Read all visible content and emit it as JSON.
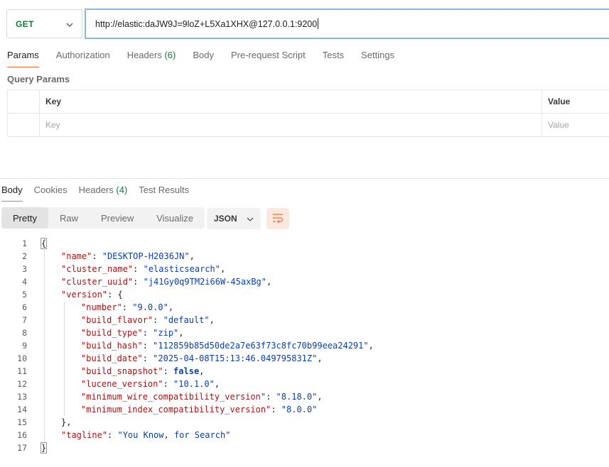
{
  "request": {
    "method": "GET",
    "url": "http://elastic:daJW9J=9loZ+L5Xa1XHX@127.0.0.1:9200"
  },
  "request_tabs": [
    {
      "label": "Params",
      "count": ""
    },
    {
      "label": "Authorization",
      "count": ""
    },
    {
      "label": "Headers",
      "count": "(6)"
    },
    {
      "label": "Body",
      "count": ""
    },
    {
      "label": "Pre-request Script",
      "count": ""
    },
    {
      "label": "Tests",
      "count": ""
    },
    {
      "label": "Settings",
      "count": ""
    }
  ],
  "query_params": {
    "title": "Query Params",
    "header_key": "Key",
    "header_value": "Value",
    "key_placeholder": "Key",
    "value_placeholder": "Value"
  },
  "response_tabs": [
    {
      "label": "Body",
      "count": ""
    },
    {
      "label": "Cookies",
      "count": ""
    },
    {
      "label": "Headers",
      "count": "(4)"
    },
    {
      "label": "Test Results",
      "count": ""
    }
  ],
  "view_modes": [
    "Pretty",
    "Raw",
    "Preview",
    "Visualize"
  ],
  "format": "JSON",
  "colors": {
    "accent": "#ff6c37",
    "method_green": "#0a7d36",
    "json_key": "#a31515",
    "json_string": "#0c3ea8"
  },
  "code_lines": [
    {
      "n": "1",
      "indent": 0,
      "tokens": [
        {
          "t": "{",
          "c": "p"
        }
      ]
    },
    {
      "n": "2",
      "indent": 1,
      "tokens": [
        {
          "t": "\"name\"",
          "c": "k"
        },
        {
          "t": ": ",
          "c": "p"
        },
        {
          "t": "\"DESKTOP-H2036JN\"",
          "c": "s"
        },
        {
          "t": ",",
          "c": "p"
        }
      ]
    },
    {
      "n": "3",
      "indent": 1,
      "tokens": [
        {
          "t": "\"cluster_name\"",
          "c": "k"
        },
        {
          "t": ": ",
          "c": "p"
        },
        {
          "t": "\"elasticsearch\"",
          "c": "s"
        },
        {
          "t": ",",
          "c": "p"
        }
      ]
    },
    {
      "n": "4",
      "indent": 1,
      "tokens": [
        {
          "t": "\"cluster_uuid\"",
          "c": "k"
        },
        {
          "t": ": ",
          "c": "p"
        },
        {
          "t": "\"j41Gy0q9TM2i66W-45axBg\"",
          "c": "s"
        },
        {
          "t": ",",
          "c": "p"
        }
      ]
    },
    {
      "n": "5",
      "indent": 1,
      "tokens": [
        {
          "t": "\"version\"",
          "c": "k"
        },
        {
          "t": ": {",
          "c": "p"
        }
      ]
    },
    {
      "n": "6",
      "indent": 2,
      "tokens": [
        {
          "t": "\"number\"",
          "c": "k"
        },
        {
          "t": ": ",
          "c": "p"
        },
        {
          "t": "\"9.0.0\"",
          "c": "s"
        },
        {
          "t": ",",
          "c": "p"
        }
      ]
    },
    {
      "n": "7",
      "indent": 2,
      "tokens": [
        {
          "t": "\"build_flavor\"",
          "c": "k"
        },
        {
          "t": ": ",
          "c": "p"
        },
        {
          "t": "\"default\"",
          "c": "s"
        },
        {
          "t": ",",
          "c": "p"
        }
      ]
    },
    {
      "n": "8",
      "indent": 2,
      "tokens": [
        {
          "t": "\"build_type\"",
          "c": "k"
        },
        {
          "t": ": ",
          "c": "p"
        },
        {
          "t": "\"zip\"",
          "c": "s"
        },
        {
          "t": ",",
          "c": "p"
        }
      ]
    },
    {
      "n": "9",
      "indent": 2,
      "tokens": [
        {
          "t": "\"build_hash\"",
          "c": "k"
        },
        {
          "t": ": ",
          "c": "p"
        },
        {
          "t": "\"112859b85d50de2a7e63f73c8fc70b99eea24291\"",
          "c": "s"
        },
        {
          "t": ",",
          "c": "p"
        }
      ]
    },
    {
      "n": "10",
      "indent": 2,
      "tokens": [
        {
          "t": "\"build_date\"",
          "c": "k"
        },
        {
          "t": ": ",
          "c": "p"
        },
        {
          "t": "\"2025-04-08T15:13:46.049795831Z\"",
          "c": "s"
        },
        {
          "t": ",",
          "c": "p"
        }
      ]
    },
    {
      "n": "11",
      "indent": 2,
      "tokens": [
        {
          "t": "\"build_snapshot\"",
          "c": "k"
        },
        {
          "t": ": ",
          "c": "p"
        },
        {
          "t": "false",
          "c": "kw"
        },
        {
          "t": ",",
          "c": "p"
        }
      ]
    },
    {
      "n": "12",
      "indent": 2,
      "tokens": [
        {
          "t": "\"lucene_version\"",
          "c": "k"
        },
        {
          "t": ": ",
          "c": "p"
        },
        {
          "t": "\"10.1.0\"",
          "c": "s"
        },
        {
          "t": ",",
          "c": "p"
        }
      ]
    },
    {
      "n": "13",
      "indent": 2,
      "tokens": [
        {
          "t": "\"minimum_wire_compatibility_version\"",
          "c": "k"
        },
        {
          "t": ": ",
          "c": "p"
        },
        {
          "t": "\"8.18.0\"",
          "c": "s"
        },
        {
          "t": ",",
          "c": "p"
        }
      ]
    },
    {
      "n": "14",
      "indent": 2,
      "tokens": [
        {
          "t": "\"minimum_index_compatibility_version\"",
          "c": "k"
        },
        {
          "t": ": ",
          "c": "p"
        },
        {
          "t": "\"8.0.0\"",
          "c": "s"
        }
      ]
    },
    {
      "n": "15",
      "indent": 1,
      "tokens": [
        {
          "t": "},",
          "c": "p"
        }
      ]
    },
    {
      "n": "16",
      "indent": 1,
      "tokens": [
        {
          "t": "\"tagline\"",
          "c": "k"
        },
        {
          "t": ": ",
          "c": "p"
        },
        {
          "t": "\"You Know, for Search\"",
          "c": "s"
        }
      ]
    },
    {
      "n": "17",
      "indent": 0,
      "tokens": [
        {
          "t": "}",
          "c": "p"
        }
      ]
    }
  ]
}
